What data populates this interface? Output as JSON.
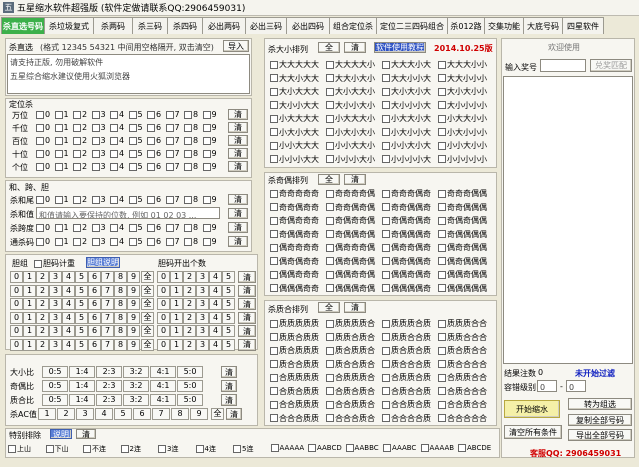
{
  "window": {
    "title": "五星缩水软件超强版 (软件定做请联系QQ:2906459031)"
  },
  "tabs": [
    "杀直选号码",
    "杀垃圾复式",
    "杀两码",
    "杀三码",
    "杀四码",
    "必出两码",
    "必出三码",
    "必出四码",
    "组合定位杀",
    "定位二三四码组合",
    "杀012路",
    "交集功能",
    "大底号码",
    "四星软件"
  ],
  "direct": {
    "label": "杀直选",
    "hint": "(格式 12345 54321 中间用空格隔开, 双击清空)",
    "import": "导入",
    "line1": "请支持正版, 勿用破解软件",
    "line2": "五星综合缩水建议使用火狐浏览器"
  },
  "position_kill": {
    "title": "定位杀",
    "rows": [
      "万位",
      "千位",
      "百位",
      "十位",
      "个位"
    ],
    "digits": [
      "0",
      "1",
      "2",
      "3",
      "4",
      "5",
      "6",
      "7",
      "8",
      "9"
    ],
    "clear": "清"
  },
  "sum_span": {
    "title": "和、跨、胆",
    "rows": [
      "杀和尾",
      "杀和值",
      "杀跨度",
      "通杀码"
    ],
    "hezhi_hint": "和值请输入要保持的位数, 例如 01 02 03 ...",
    "clear": "清"
  },
  "dan": {
    "label": "胆组",
    "count_label": "胆码计重",
    "explain": "胆组说明",
    "right_label": "胆码开出个数",
    "nums": [
      "0",
      "1",
      "2",
      "3",
      "4",
      "5",
      "6",
      "7",
      "8",
      "9"
    ],
    "all": "全",
    "clear": "清"
  },
  "ratios": {
    "rows": [
      {
        "label": "大小比",
        "opts": [
          "0:5",
          "1:4",
          "2:3",
          "3:2",
          "4:1",
          "5:0"
        ]
      },
      {
        "label": "奇偶比",
        "opts": [
          "0:5",
          "1:4",
          "2:3",
          "3:2",
          "4:1",
          "5:0"
        ]
      },
      {
        "label": "质合比",
        "opts": [
          "0:5",
          "1:4",
          "2:3",
          "3:2",
          "4:1",
          "5:0"
        ]
      }
    ],
    "ac_label": "杀AC值",
    "ac_opts": [
      "1",
      "2",
      "3",
      "4",
      "5",
      "6",
      "7",
      "8",
      "9"
    ],
    "all": "全",
    "clear": "清"
  },
  "special": {
    "title": "特别排除",
    "explain": "说明",
    "clear": "清",
    "items": [
      "上山",
      "下山",
      "不连",
      "2连",
      "3连",
      "4连",
      "5连",
      "AAAAA",
      "AABCD",
      "AABBC",
      "AAABC",
      "AAAAB",
      "ABCDE"
    ]
  },
  "bigsmall": {
    "title": "杀大小排列",
    "all": "全",
    "clear": "清",
    "tutorial": "软件使用教程",
    "date": "2014.10.25版",
    "items": [
      [
        "大大大大大",
        "大大大大小",
        "大大大小大",
        "大大大小小"
      ],
      [
        "大大小大大",
        "大大小大小",
        "大大小小大",
        "大大小小小"
      ],
      [
        "大小大大大",
        "大小大大小",
        "大小大小大",
        "大小大小小"
      ],
      [
        "大小小大大",
        "大小小大小",
        "大小小小大",
        "大小小小小"
      ],
      [
        "小大大大大",
        "小大大大小",
        "小大大小大",
        "小大大小小"
      ],
      [
        "小大小大大",
        "小大小大小",
        "小大小小大",
        "小大小小小"
      ],
      [
        "小小大大大",
        "小小大大小",
        "小小大小大",
        "小小大小小"
      ],
      [
        "小小小大大",
        "小小小大小",
        "小小小小大",
        "小小小小小"
      ]
    ]
  },
  "oddeven": {
    "title": "杀奇偶排列",
    "all": "全",
    "clear": "清",
    "items": [
      [
        "奇奇奇奇奇",
        "奇奇奇奇偶",
        "奇奇奇偶奇",
        "奇奇奇偶偶"
      ],
      [
        "奇奇偶奇奇",
        "奇奇偶奇偶",
        "奇奇偶偶奇",
        "奇奇偶偶偶"
      ],
      [
        "奇偶奇奇奇",
        "奇偶奇奇偶",
        "奇偶奇偶奇",
        "奇偶奇偶偶"
      ],
      [
        "奇偶偶奇奇",
        "奇偶偶奇偶",
        "奇偶偶偶奇",
        "奇偶偶偶偶"
      ],
      [
        "偶奇奇奇奇",
        "偶奇奇奇偶",
        "偶奇奇偶奇",
        "偶奇奇偶偶"
      ],
      [
        "偶奇偶奇奇",
        "偶奇偶奇偶",
        "偶奇偶偶奇",
        "偶奇偶偶偶"
      ],
      [
        "偶偶奇奇奇",
        "偶偶奇奇偶",
        "偶偶奇偶奇",
        "偶偶奇偶偶"
      ],
      [
        "偶偶偶奇奇",
        "偶偶偶奇偶",
        "偶偶偶偶奇",
        "偶偶偶偶偶"
      ]
    ]
  },
  "primecomp": {
    "title": "杀质合排列",
    "all": "全",
    "clear": "清",
    "items": [
      [
        "质质质质质",
        "质质质质合",
        "质质质合质",
        "质质质合合"
      ],
      [
        "质质合质质",
        "质质合质合",
        "质质合合质",
        "质质合合合"
      ],
      [
        "质合质质质",
        "质合质质合",
        "质合质合质",
        "质合质合合"
      ],
      [
        "质合合质质",
        "质合合质合",
        "质合合合质",
        "质合合合合"
      ],
      [
        "合质质质质",
        "合质质质合",
        "合质质合质",
        "合质质合合"
      ],
      [
        "合质合质质",
        "合质合质合",
        "合质合合质",
        "合质合合合"
      ],
      [
        "合合质质质",
        "合合质质合",
        "合合质合质",
        "合合质合合"
      ],
      [
        "合合合质质",
        "合合合质合",
        "合合合合质",
        "合合合合合"
      ]
    ]
  },
  "right": {
    "welcome": "欢迎使用",
    "input_label": "输入奖号",
    "match": "兑奖匹配",
    "result_label": "结果注数",
    "result_val": "0",
    "status": "未开始过滤",
    "tolerance_label": "容错级别",
    "tol_from": "0",
    "tol_to": "0",
    "start": "开始缩水",
    "to_group": "转为组选",
    "clear_all": "清空所有条件",
    "copy": "复制全部号码",
    "export": "导出全部号码",
    "qq": "客服QQ: 2906459031"
  }
}
